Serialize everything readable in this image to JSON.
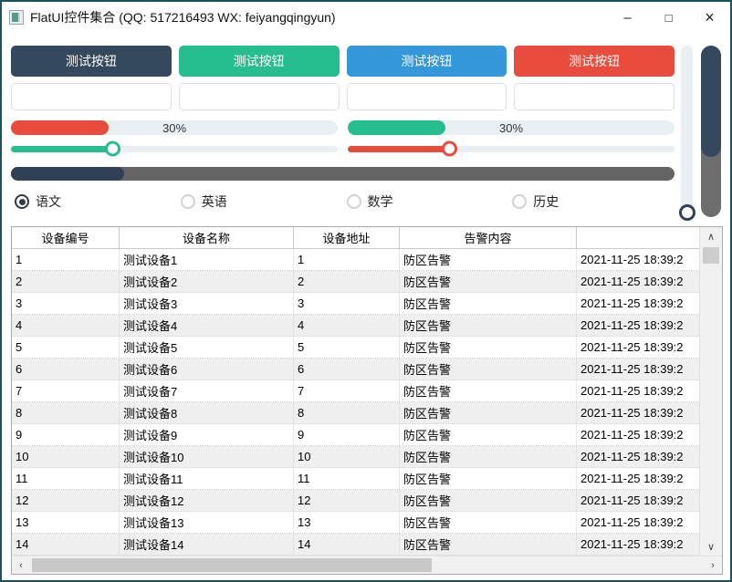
{
  "colors": {
    "windowBorder": "#1C5360",
    "navy": "#34495E",
    "navyDark": "#2F4154",
    "green": "#27BE8D",
    "blue": "#3498DB",
    "red": "#E74C3C",
    "trackLight": "#EAEFF2",
    "darkTrack": "#646464",
    "grayFill": "#6E6E6E"
  },
  "titlebar": {
    "title": "FlatUI控件集合 (QQ: 517216493 WX: feiyangqingyun)",
    "minimize_label": "–",
    "maximize_label": "□",
    "close_label": "×"
  },
  "buttons": [
    {
      "label": "测试按钮",
      "color": "#34495E"
    },
    {
      "label": "测试按钮",
      "color": "#27BE8D"
    },
    {
      "label": "测试按钮",
      "color": "#3498DB"
    },
    {
      "label": "测试按钮",
      "color": "#E74C3C"
    }
  ],
  "inputs": [
    {
      "value": ""
    },
    {
      "value": ""
    },
    {
      "value": ""
    },
    {
      "value": ""
    }
  ],
  "progress_bars": [
    {
      "label": "30%",
      "percent": 30,
      "color": "#E74C3C"
    },
    {
      "label": "30%",
      "percent": 30,
      "color": "#27BE8D"
    }
  ],
  "sliders": [
    {
      "percent": 31,
      "color": "#27BE8D"
    },
    {
      "percent": 31,
      "color": "#E74C3C"
    }
  ],
  "dark_progress": {
    "percent": 17
  },
  "vertical_slider": {
    "percent": 0
  },
  "vertical_progress": {
    "percent": 65
  },
  "radios": [
    {
      "label": "语文",
      "checked": true
    },
    {
      "label": "英语",
      "checked": false
    },
    {
      "label": "数学",
      "checked": false
    },
    {
      "label": "历史",
      "checked": false
    }
  ],
  "table": {
    "headers": [
      "设备编号",
      "设备名称",
      "设备地址",
      "告警内容",
      ""
    ],
    "rows": [
      [
        "1",
        "测试设备1",
        "1",
        "防区告警",
        "2021-11-25 18:39:2"
      ],
      [
        "2",
        "测试设备2",
        "2",
        "防区告警",
        "2021-11-25 18:39:2"
      ],
      [
        "3",
        "测试设备3",
        "3",
        "防区告警",
        "2021-11-25 18:39:2"
      ],
      [
        "4",
        "测试设备4",
        "4",
        "防区告警",
        "2021-11-25 18:39:2"
      ],
      [
        "5",
        "测试设备5",
        "5",
        "防区告警",
        "2021-11-25 18:39:2"
      ],
      [
        "6",
        "测试设备6",
        "6",
        "防区告警",
        "2021-11-25 18:39:2"
      ],
      [
        "7",
        "测试设备7",
        "7",
        "防区告警",
        "2021-11-25 18:39:2"
      ],
      [
        "8",
        "测试设备8",
        "8",
        "防区告警",
        "2021-11-25 18:39:2"
      ],
      [
        "9",
        "测试设备9",
        "9",
        "防区告警",
        "2021-11-25 18:39:2"
      ],
      [
        "10",
        "测试设备10",
        "10",
        "防区告警",
        "2021-11-25 18:39:2"
      ],
      [
        "11",
        "测试设备11",
        "11",
        "防区告警",
        "2021-11-25 18:39:2"
      ],
      [
        "12",
        "测试设备12",
        "12",
        "防区告警",
        "2021-11-25 18:39:2"
      ],
      [
        "13",
        "测试设备13",
        "13",
        "防区告警",
        "2021-11-25 18:39:2"
      ],
      [
        "14",
        "测试设备14",
        "14",
        "防区告警",
        "2021-11-25 18:39:2"
      ]
    ],
    "scrollbar_icons": {
      "up": "∧",
      "down": "∨",
      "left": "‹",
      "right": "›"
    }
  }
}
